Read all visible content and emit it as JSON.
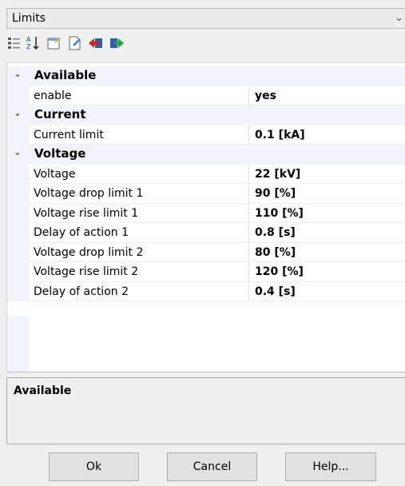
{
  "panel": {
    "title": "Limits",
    "dropdown_icon": "chevron-down-icon"
  },
  "toolbar": {
    "icons": [
      "categorized-icon",
      "alphabetical-sort-icon",
      "property-pages-icon",
      "edit-properties-icon",
      "import-icon",
      "export-icon"
    ]
  },
  "grid": {
    "categories": [
      {
        "label": "Available",
        "expanded": true,
        "properties": [
          {
            "name": "enable",
            "value": "yes"
          }
        ]
      },
      {
        "label": "Current",
        "expanded": true,
        "properties": [
          {
            "name": "Current limit",
            "value": "0.1 [kA]"
          }
        ]
      },
      {
        "label": "Voltage",
        "expanded": true,
        "properties": [
          {
            "name": "Voltage",
            "value": "22 [kV]"
          },
          {
            "name": "Voltage drop limit 1",
            "value": "90 [%]"
          },
          {
            "name": "Voltage rise limit 1",
            "value": "110 [%]"
          },
          {
            "name": "Delay of action 1",
            "value": "0.8 [s]"
          },
          {
            "name": "Voltage drop limit 2",
            "value": "80 [%]"
          },
          {
            "name": "Voltage rise limit 2",
            "value": "120 [%]"
          },
          {
            "name": "Delay of action 2",
            "value": "0.4 [s]"
          }
        ]
      }
    ]
  },
  "description": {
    "title": "Available"
  },
  "buttons": {
    "ok": "Ok",
    "cancel": "Cancel",
    "help": "Help..."
  }
}
